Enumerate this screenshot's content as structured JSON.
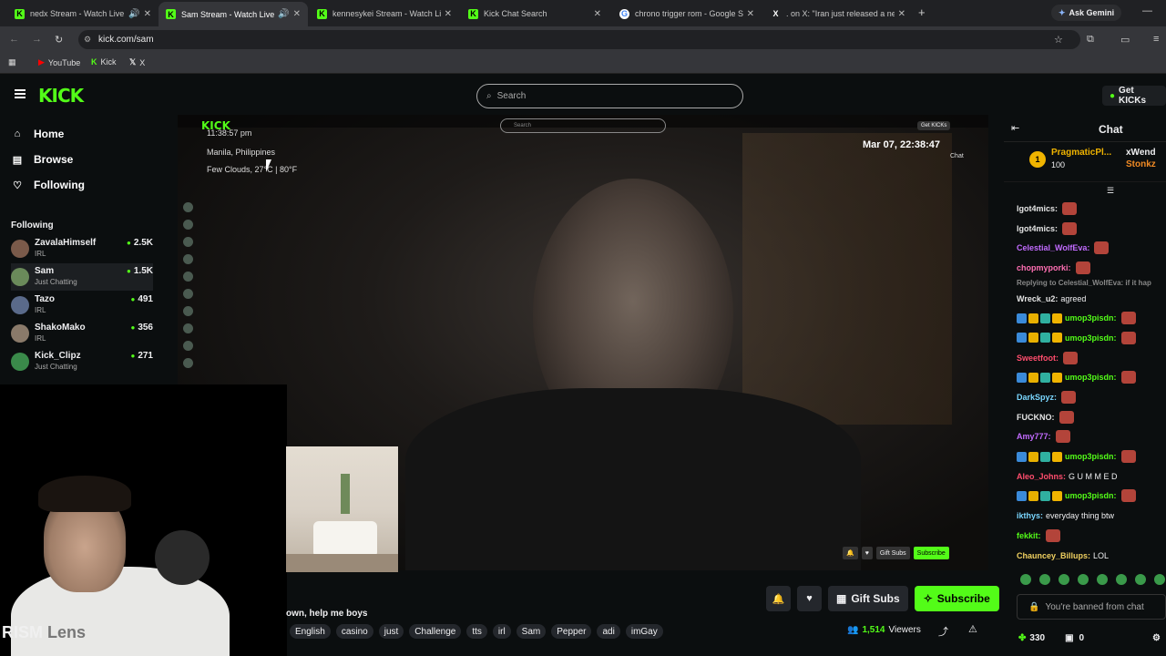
{
  "browser": {
    "tabs": [
      {
        "title": "nedx Stream - Watch Live o",
        "favicon": "K"
      },
      {
        "title": "Sam Stream - Watch Live o",
        "favicon": "K"
      },
      {
        "title": "kennesykei Stream - Watch Liv",
        "favicon": "K"
      },
      {
        "title": "Kick Chat Search",
        "favicon": "K"
      },
      {
        "title": "chrono trigger rom - Google Se",
        "favicon": "G"
      },
      {
        "title": ". on X: \"Iran just released a new",
        "favicon": "X"
      }
    ],
    "ask_gemini": "Ask Gemini",
    "url": "kick.com/sam",
    "bookmarks": [
      "YouTube",
      "Kick",
      "X"
    ]
  },
  "site": {
    "logo": "KICK",
    "search_placeholder": "Search",
    "get_kicks": "Get KICKs",
    "nav": [
      {
        "label": "Home",
        "icon": "home-icon"
      },
      {
        "label": "Browse",
        "icon": "browse-icon"
      },
      {
        "label": "Following",
        "icon": "heart-icon"
      }
    ],
    "following_header": "Following",
    "following": [
      {
        "name": "ZavalaHimself",
        "category": "IRL",
        "viewers": "2.5K"
      },
      {
        "name": "Sam",
        "category": "Just Chatting",
        "viewers": "1.5K"
      },
      {
        "name": "Tazo",
        "category": "IRL",
        "viewers": "491"
      },
      {
        "name": "ShakoMako",
        "category": "IRL",
        "viewers": "356"
      },
      {
        "name": "Kick_Clipz",
        "category": "Just Chatting",
        "viewers": "271"
      }
    ]
  },
  "video_overlay": {
    "logo": "KICK",
    "time": "11:38:57 pm",
    "location": "Manila, Philippines",
    "weather": "Few Clouds, 27°C | 80°F",
    "date": "Mar 07, 22:38:47",
    "chat_label": "Chat",
    "search": "Search",
    "get_kicks": "Get KICKs",
    "gift_subs": "Gift Subs",
    "subscribe": "Subscribe"
  },
  "webcam_label": {
    "bright": "RISM",
    "dim": "Lens"
  },
  "stream": {
    "title": "own, help me boys",
    "tags": [
      "English",
      "casino",
      "just",
      "Challenge",
      "tts",
      "irl",
      "Sam",
      "Pepper",
      "adi",
      "imGay"
    ],
    "gift_subs": "Gift Subs",
    "subscribe": "Subscribe",
    "viewers_count": "1,514",
    "viewers_label": "Viewers"
  },
  "chat": {
    "title": "Chat",
    "pinned": {
      "name": "PragmaticPl...",
      "count": "100",
      "right1": "xWend",
      "right2": "Stonkz"
    },
    "messages": [
      {
        "user": "lgot4mics:",
        "color": "#e6e6e6",
        "text": ""
      },
      {
        "user": "lgot4mics:",
        "color": "#e6e6e6",
        "text": ""
      },
      {
        "user": "Celestial_WolfEva:",
        "color": "#c26bff",
        "text": ""
      },
      {
        "user": "chopmyporki:",
        "color": "#ff6fb3",
        "text": ""
      },
      {
        "user": "Replying to Celestial_WolfEva: if it hap",
        "color": "#888888",
        "text": "",
        "reply": true
      },
      {
        "user": "Wreck_u2:",
        "color": "#e6e6e6",
        "text": "agreed"
      },
      {
        "user": "umop3pisdn:",
        "color": "#53fc18",
        "text": ""
      },
      {
        "user": "umop3pisdn:",
        "color": "#53fc18",
        "text": ""
      },
      {
        "user": "Sweetfoot:",
        "color": "#ff4d6d",
        "text": ""
      },
      {
        "user": "umop3pisdn:",
        "color": "#53fc18",
        "text": ""
      },
      {
        "user": "DarkSpyz:",
        "color": "#7ad7ff",
        "text": ""
      },
      {
        "user": "FUCKNO:",
        "color": "#e6e6e6",
        "text": ""
      },
      {
        "user": "Amy777:",
        "color": "#c26bff",
        "text": ""
      },
      {
        "user": "umop3pisdn:",
        "color": "#53fc18",
        "text": ""
      },
      {
        "user": "Aleo_Johns:",
        "color": "#ff4d6d",
        "text": "G U M M E D"
      },
      {
        "user": "umop3pisdn:",
        "color": "#53fc18",
        "text": ""
      },
      {
        "user": "ikthys:",
        "color": "#7ad7ff",
        "text": "everyday thing btw"
      },
      {
        "user": "fekkit:",
        "color": "#53fc18",
        "text": ""
      },
      {
        "user": "Chauncey_Billups:",
        "color": "#f0d060",
        "text": "LOL"
      }
    ],
    "banned": "You're banned from chat",
    "kicks": "330",
    "gifts": "0"
  }
}
